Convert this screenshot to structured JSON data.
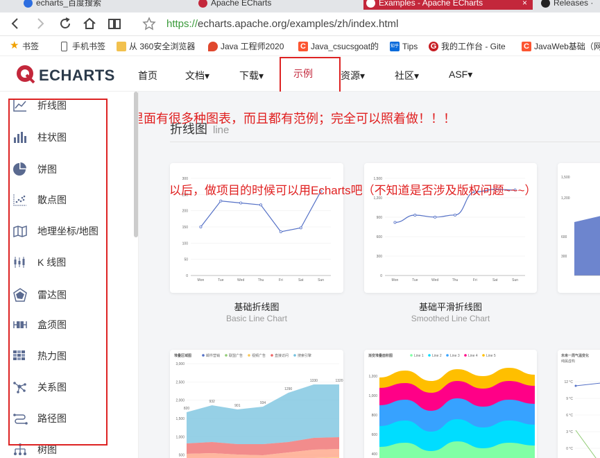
{
  "browser": {
    "tabs": [
      {
        "title": "echarts_百度搜索",
        "active": false
      },
      {
        "title": "Apache ECharts",
        "active": false
      },
      {
        "title": "Examples - Apache ECharts",
        "active": true
      },
      {
        "title": "Releases ·",
        "active": false
      }
    ],
    "close_glyph": "×",
    "url_protocol": "https://",
    "url_rest": "echarts.apache.org/examples/zh/index.html",
    "bookmarks": [
      {
        "label": "书签",
        "icon": "star-icon"
      },
      {
        "label": "手机书签",
        "icon": "phone-icon"
      },
      {
        "label": "从 360安全浏览器",
        "icon": "folder-icon"
      },
      {
        "label": "Java 工程师2020",
        "icon": "fire-icon"
      },
      {
        "label": "Java_csucsgoat的",
        "icon": "csdn-icon"
      },
      {
        "label": "Tips",
        "icon": "zhihu-icon"
      },
      {
        "label": "我的工作台 - Gite",
        "icon": "gitee-icon"
      },
      {
        "label": "JavaWeb基础（网",
        "icon": "csdn-icon"
      }
    ],
    "zhihu_badge": "知乎"
  },
  "site": {
    "logo_text": "ECHARTS",
    "nav": [
      {
        "label": "首页",
        "dropdown": false
      },
      {
        "label": "文档",
        "dropdown": true
      },
      {
        "label": "下载",
        "dropdown": true
      },
      {
        "label": "示例",
        "dropdown": false,
        "active": true
      },
      {
        "label": "资源",
        "dropdown": true
      },
      {
        "label": "社区",
        "dropdown": true
      },
      {
        "label": "ASF",
        "dropdown": true
      }
    ],
    "dropdown_glyph": "▾"
  },
  "sidebar": {
    "items": [
      {
        "label": "折线图",
        "icon": "line-chart-icon"
      },
      {
        "label": "柱状图",
        "icon": "bar-chart-icon"
      },
      {
        "label": "饼图",
        "icon": "pie-chart-icon"
      },
      {
        "label": "散点图",
        "icon": "scatter-chart-icon"
      },
      {
        "label": "地理坐标/地图",
        "icon": "map-icon"
      },
      {
        "label": "K 线图",
        "icon": "candlestick-icon"
      },
      {
        "label": "雷达图",
        "icon": "radar-icon"
      },
      {
        "label": "盒须图",
        "icon": "boxplot-icon"
      },
      {
        "label": "热力图",
        "icon": "heatmap-icon"
      },
      {
        "label": "关系图",
        "icon": "graph-icon"
      },
      {
        "label": "路径图",
        "icon": "lines-icon"
      },
      {
        "label": "树图",
        "icon": "tree-icon"
      }
    ]
  },
  "annotations": {
    "top": "里面有很多种图表，而且都有范例；完全可以照着做！！！",
    "middle": "以后，做项目的时候可以用Echarts吧（不知道是否涉及版权问题~~~）"
  },
  "section": {
    "title": "折线图",
    "subtitle": "line"
  },
  "cards": [
    {
      "title": "基础折线图",
      "subtitle": "Basic Line Chart"
    },
    {
      "title": "基础平滑折线图",
      "subtitle": "Smoothed Line Chart"
    }
  ],
  "thumbnails": {
    "days": [
      "Mon",
      "Tue",
      "Wed",
      "Thu",
      "Fri",
      "Sat",
      "Sun"
    ],
    "basic_line": {
      "y_ticks": [
        "0",
        "50",
        "100",
        "150",
        "200",
        "250",
        "300"
      ],
      "values": [
        150,
        230,
        224,
        218,
        135,
        147,
        260
      ],
      "ymax": 300
    },
    "smooth_line": {
      "y_ticks": [
        "0",
        "300",
        "600",
        "900",
        "1,200",
        "1,500"
      ],
      "values": [
        820,
        932,
        901,
        934,
        1290,
        1330,
        1320
      ],
      "ymax": 1500
    },
    "stacked_area": {
      "title": "堆叠区域图",
      "legend": [
        "邮件营销",
        "联盟广告",
        "视频广告",
        "直接访问",
        "搜索引擎"
      ],
      "y_ticks": [
        "500",
        "1,000",
        "1,500",
        "2,000",
        "2,500",
        "3,000"
      ],
      "labels": [
        "820",
        "932",
        "901",
        "934",
        "1290",
        "1330",
        "1320"
      ]
    },
    "gradient_area": {
      "title": "渐变堆叠面积图",
      "legend": [
        "Line 1",
        "Line 2",
        "Line 3",
        "Line 4",
        "Line 5"
      ],
      "y_ticks": [
        "400",
        "600",
        "800",
        "1,000",
        "1,200"
      ]
    },
    "temperature": {
      "title": "未来一周气温变化",
      "subtitle": "纯属虚构",
      "y_ticks": [
        "12 °C",
        "9 °C",
        "6 °C",
        "3 °C",
        "0 °C"
      ]
    }
  }
}
